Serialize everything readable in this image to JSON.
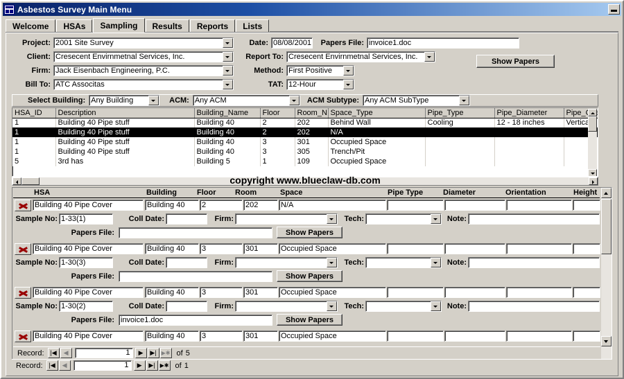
{
  "window": {
    "title": "Asbestos Survey Main Menu",
    "icon": "database-window-icon",
    "minimize_label": "_"
  },
  "tabs": [
    {
      "label": "Welcome",
      "active": false
    },
    {
      "label": "HSAs",
      "active": false
    },
    {
      "label": "Sampling",
      "active": true
    },
    {
      "label": "Results",
      "active": false
    },
    {
      "label": "Reports",
      "active": false
    },
    {
      "label": "Lists",
      "active": false
    }
  ],
  "header": {
    "project_label": "Project:",
    "project_value": "2001 Site Survey",
    "client_label": "Client:",
    "client_value": "Cresecent Envirnmetnal Services, Inc.",
    "firm_label": "Firm:",
    "firm_value": "Jack Eisenbach Engineering, P.C.",
    "billto_label": "Bill To:",
    "billto_value": "ATC Associtas",
    "date_label": "Date:",
    "date_value": "08/08/2001",
    "papers_file_label": "Papers File:",
    "papers_file_value": "invoice1.doc",
    "report_to_label": "Report To:",
    "report_to_value": "Cresecent Envirnmetnal Services, Inc.",
    "method_label": "Method:",
    "method_value": "First Positive",
    "tat_label": "TAT:",
    "tat_value": "12-Hour",
    "show_papers_label": "Show Papers"
  },
  "filters": {
    "building_label": "Select Building:",
    "building_value": "Any Building",
    "acm_label": "ACM:",
    "acm_value": "Any ACM",
    "acm_subtype_label": "ACM Subtype:",
    "acm_subtype_value": "Any ACM SubType"
  },
  "datasheet": {
    "columns": [
      "HSA_ID",
      "Description",
      "Building_Name",
      "Floor",
      "Room_N",
      "Space_Type",
      "Pipe_Type",
      "Pipe_Diameter",
      "Pipe_Orient"
    ],
    "rows": [
      {
        "selected": false,
        "cells": [
          "1",
          "Building 40 Pipe stuff",
          "Building 40",
          "2",
          "202",
          "Behind Wall",
          "Cooling",
          "12 - 18 inches",
          "Vertical"
        ]
      },
      {
        "selected": true,
        "cells": [
          "1",
          "Building 40 Pipe stuff",
          "Building 40",
          "2",
          "202",
          "N/A",
          "",
          "",
          ""
        ]
      },
      {
        "selected": false,
        "cells": [
          "1",
          "Building 40 Pipe stuff",
          "Building 40",
          "3",
          "301",
          "Occupied Space",
          "",
          "",
          ""
        ]
      },
      {
        "selected": false,
        "cells": [
          "1",
          "Building 40 Pipe stuff",
          "Building 40",
          "3",
          "305",
          "Trench/Pit",
          "",
          "",
          ""
        ]
      },
      {
        "selected": false,
        "cells": [
          "5",
          "3rd has",
          "Building 5",
          "1",
          "109",
          "Occupied Space",
          "",
          "",
          ""
        ]
      }
    ]
  },
  "watermark": "copyright www.blueclaw-db.com",
  "subform": {
    "headers": [
      "HSA",
      "Building",
      "Floor",
      "Room",
      "Space",
      "Pipe Type",
      "Diameter",
      "Orientation",
      "Height"
    ],
    "labels": {
      "sample_no": "Sample No:",
      "coll_date": "Coll Date:",
      "firm": "Firm:",
      "tech": "Tech:",
      "note": "Note:",
      "papers_file": "Papers File:",
      "show_papers": "Show Papers",
      "delete_icon": "delete-record-icon"
    },
    "records": [
      {
        "hsa": "Building 40 Pipe Cover",
        "building": "Building 40",
        "floor": "2",
        "room": "202",
        "space": "N/A",
        "pipe_type": "",
        "diameter": "",
        "orientation": "",
        "height": "",
        "sample_no": "1-33(1)",
        "coll_date": "",
        "firm": "",
        "tech": "",
        "note": "",
        "papers_file": ""
      },
      {
        "hsa": "Building 40 Pipe Cover",
        "building": "Building 40",
        "floor": "3",
        "room": "301",
        "space": "Occupied Space",
        "pipe_type": "",
        "diameter": "",
        "orientation": "",
        "height": "",
        "sample_no": "1-30(3)",
        "coll_date": "",
        "firm": "",
        "tech": "",
        "note": "",
        "papers_file": ""
      },
      {
        "hsa": "Building 40 Pipe Cover",
        "building": "Building 40",
        "floor": "3",
        "room": "301",
        "space": "Occupied Space",
        "pipe_type": "",
        "diameter": "",
        "orientation": "",
        "height": "",
        "sample_no": "1-30(2)",
        "coll_date": "",
        "firm": "",
        "tech": "",
        "note": "",
        "papers_file": "invoice1.doc"
      },
      {
        "hsa": "Building 40 Pipe Cover",
        "building": "Building 40",
        "floor": "3",
        "room": "301",
        "space": "Occupied Space",
        "pipe_type": "",
        "diameter": "",
        "orientation": "",
        "height": "",
        "sample_no": "",
        "coll_date": "",
        "firm": "",
        "tech": "",
        "note": "",
        "papers_file": ""
      }
    ],
    "nav": {
      "record_label": "Record:",
      "current": "1",
      "of_label": "of",
      "total": "5",
      "first_glyph": "|◀",
      "prev_glyph": "◀",
      "next_glyph": "▶",
      "last_glyph": "▶|",
      "new_glyph": "▶✱"
    }
  },
  "main_nav": {
    "record_label": "Record:",
    "current": "1",
    "of_label": "of",
    "total": "1",
    "first_glyph": "|◀",
    "prev_glyph": "◀",
    "next_glyph": "▶",
    "last_glyph": "▶|",
    "new_glyph": "▶✱"
  },
  "colors": {
    "titlebar": "#0a246a",
    "face": "#d4d0c8",
    "selection": "#000000",
    "delete_icon": "#990000"
  }
}
